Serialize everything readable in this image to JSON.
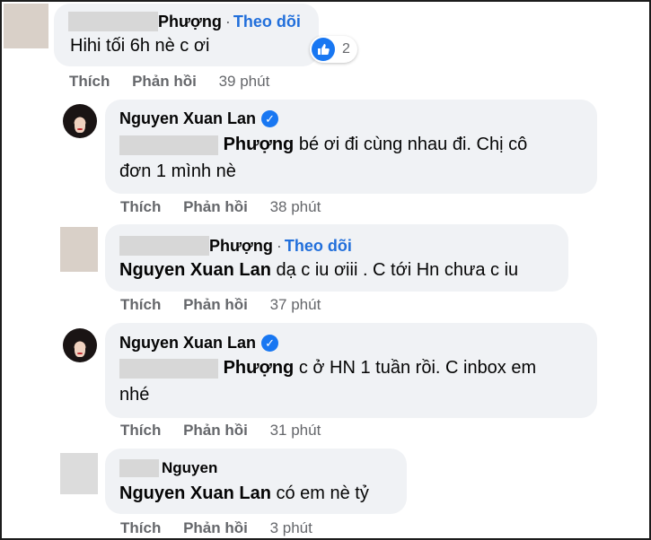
{
  "comments": [
    {
      "author": "Phượng",
      "follow": "Theo dõi",
      "text": "Hihi tối 6h nè c ơi",
      "reaction_count": "2",
      "actions": {
        "like": "Thích",
        "reply": "Phản hồi",
        "time": "39 phút"
      }
    },
    {
      "author": "Nguyen Xuan Lan",
      "mention": "Phượng",
      "text_line1": " bé ơi đi cùng nhau đi. Chị cô",
      "text_line2": "đơn 1 mình nè",
      "actions": {
        "like": "Thích",
        "reply": "Phản hồi",
        "time": "38 phút"
      }
    },
    {
      "author": "Phượng",
      "follow": "Theo dõi",
      "mention": "Nguyen Xuan Lan",
      "text": " dạ c iu ơiii . C tới Hn chưa c iu",
      "actions": {
        "like": "Thích",
        "reply": "Phản hồi",
        "time": "37 phút"
      }
    },
    {
      "author": "Nguyen Xuan Lan",
      "mention": "Phượng",
      "text_line1": " c ở HN 1 tuần rồi. C inbox em",
      "text_line2": "nhé",
      "actions": {
        "like": "Thích",
        "reply": "Phản hồi",
        "time": "31 phút"
      }
    },
    {
      "author": "Nguyen",
      "mention": "Nguyen Xuan Lan",
      "text": " có em nè tỷ",
      "actions": {
        "like": "Thích",
        "reply": "Phản hồi",
        "time": "3 phút"
      }
    }
  ],
  "icons": {
    "like": "thumbs-up-icon",
    "verified": "verified-badge-icon"
  },
  "colors": {
    "bubble": "#f0f2f5",
    "link": "#216fdb",
    "meta": "#65676b",
    "brand": "#1877f2"
  }
}
